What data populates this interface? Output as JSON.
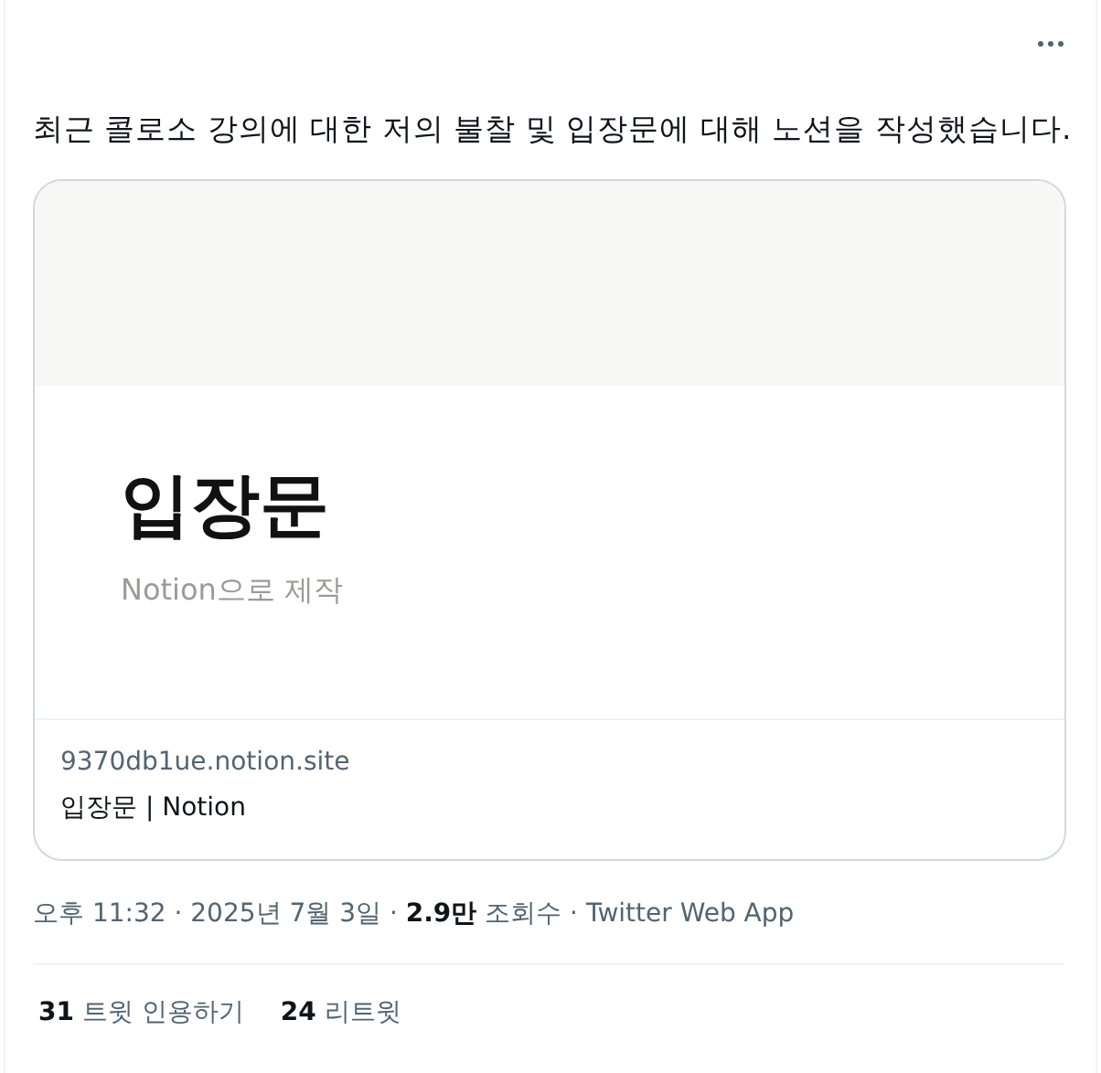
{
  "tweet": {
    "text": "최근 콜로소 강의에 대한 저의 불찰 및 입장문에 대해 노션을 작성했습니다."
  },
  "card": {
    "preview_title": "입장문",
    "preview_subtitle": "Notion으로 제작",
    "domain": "9370db1ue.notion.site",
    "title": "입장문 | Notion"
  },
  "meta": "오후 11:32 · 2025년 7월 3일 · **2.9만** 조회수 · Twitter Web App",
  "stats": [
    {
      "text": "**31** 트윗 인용하기"
    },
    {
      "text": "**24** 리트윗"
    }
  ]
}
